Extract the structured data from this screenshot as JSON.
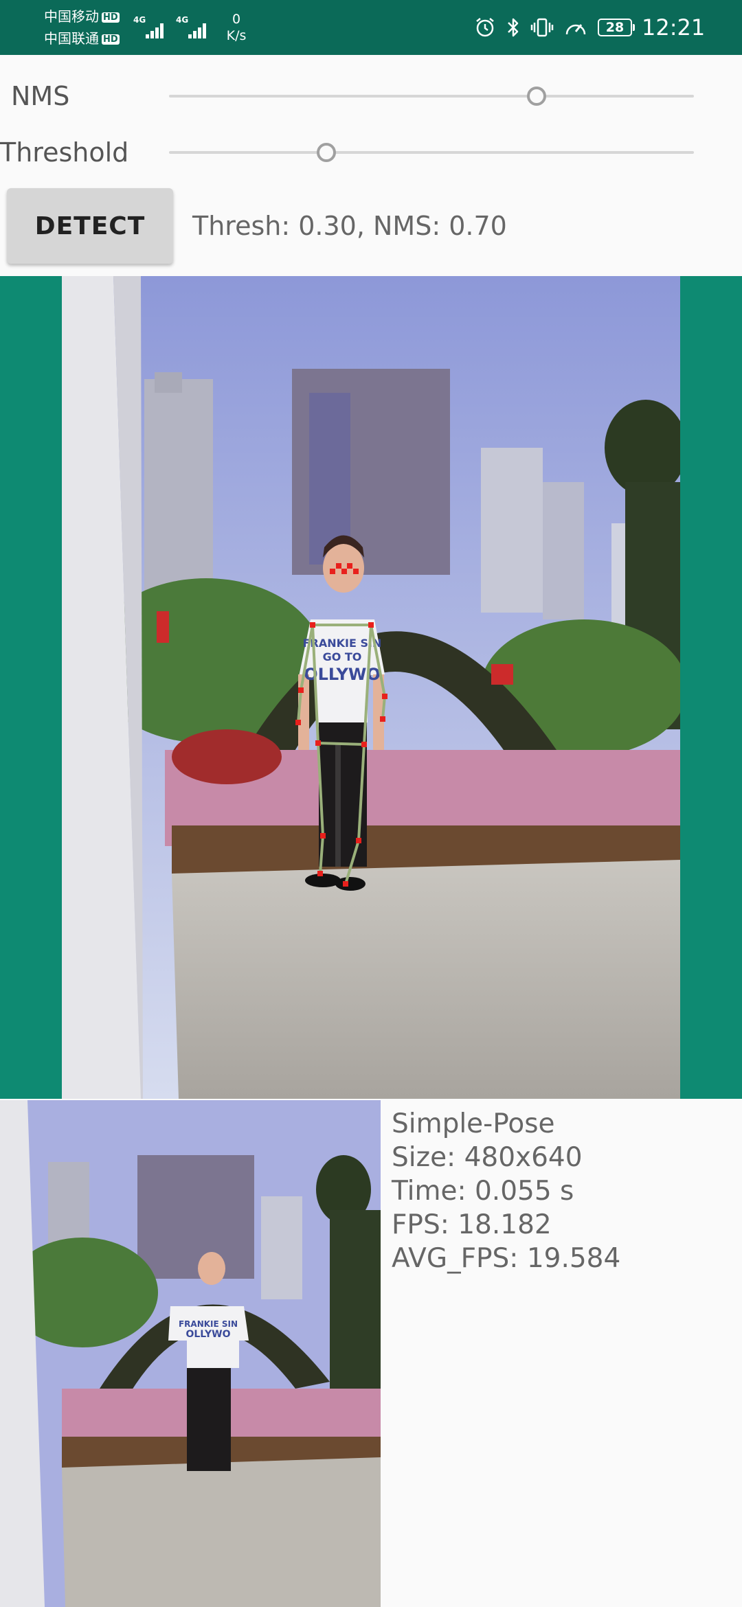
{
  "status_bar": {
    "carrier_1": "中国移动",
    "carrier_2": "中国联通",
    "hd_badge": "HD",
    "network_type_1": "4G",
    "network_type_2": "4G",
    "net_speed_value": "0",
    "net_speed_unit": "K/s",
    "icons": [
      "alarm-icon",
      "bluetooth-icon",
      "vibrate-icon",
      "speed-gauge-icon"
    ],
    "battery_level": "28",
    "time": "12:21",
    "background_color": "#0b6a58"
  },
  "controls": {
    "nms_label": "NMS",
    "nms_value": 0.7,
    "threshold_label": "Threshold",
    "threshold_value": 0.3,
    "detect_button_label": "DETECT",
    "params_text": "Thresh: 0.30, NMS: 0.70"
  },
  "result_view": {
    "background_color": "#0e8a72",
    "keypoint_color": "#e8201c",
    "skeleton_color": "#9ab07a"
  },
  "info": {
    "model": "Simple-Pose",
    "size": "Size: 480x640",
    "time": "Time: 0.055 s",
    "fps": "FPS: 18.182",
    "avg_fps": "AVG_FPS: 19.584"
  }
}
